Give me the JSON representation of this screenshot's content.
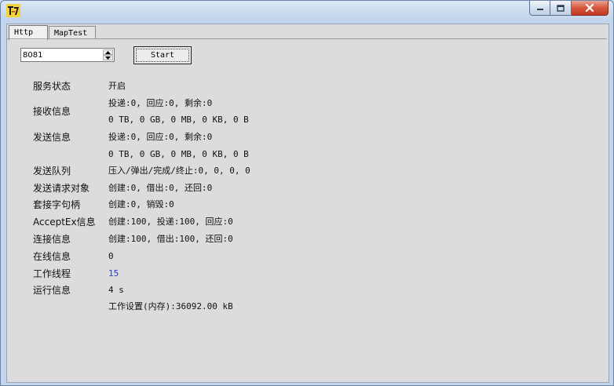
{
  "tabs": [
    {
      "label": "Http"
    },
    {
      "label": "MapTest"
    }
  ],
  "controls": {
    "port_value": "8081",
    "start_label": "Start"
  },
  "info": {
    "service_status": {
      "label": "服务状态",
      "value": "开启"
    },
    "receive": {
      "label": "接收信息",
      "value": "投递:0, 回应:0, 剩余:0",
      "bytes": "0 TB, 0 GB, 0 MB, 0 KB, 0 B"
    },
    "send": {
      "label": "发送信息",
      "value": "投递:0, 回应:0, 剩余:0",
      "bytes": "0 TB, 0 GB, 0 MB, 0 KB, 0 B"
    },
    "send_queue": {
      "label": "发送队列",
      "value": "压入/弹出/完成/终止:0, 0, 0, 0"
    },
    "send_request": {
      "label": "发送请求对象",
      "value": "创建:0, 借出:0, 还回:0"
    },
    "socket_handle": {
      "label": "套接字句柄",
      "value": "创建:0, 销毁:0"
    },
    "acceptex": {
      "label": "AcceptEx信息",
      "value": "创建:100, 投递:100, 回应:0"
    },
    "connection": {
      "label": "连接信息",
      "value": "创建:100, 借出:100, 还回:0"
    },
    "online": {
      "label": "在线信息",
      "value": "0"
    },
    "worker_threads": {
      "label": "工作线程",
      "value": "15"
    },
    "runtime": {
      "label": "运行信息",
      "value": "4 s",
      "memory": "工作设置(内存):36092.00 kB"
    }
  },
  "colors": {
    "thread_count": "#1f3fd0",
    "close_button": "#c83c25"
  }
}
